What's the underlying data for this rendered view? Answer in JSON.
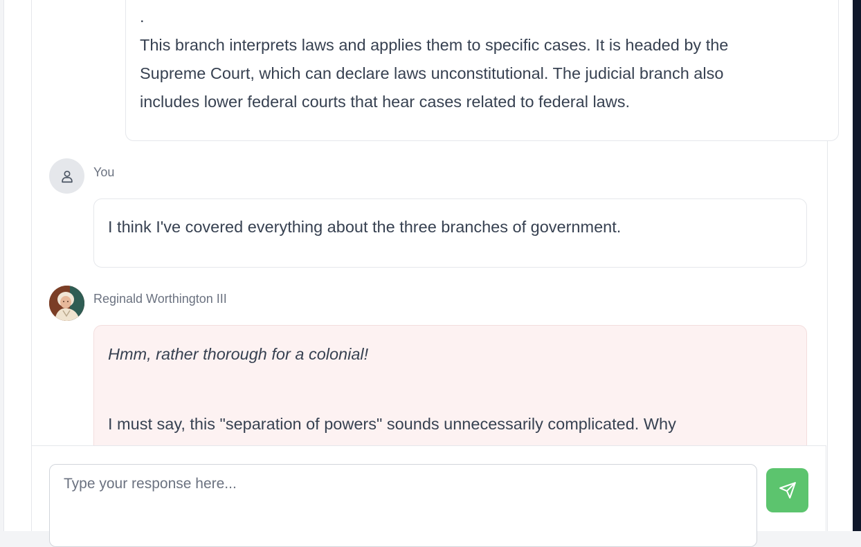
{
  "messages": [
    {
      "sender": "",
      "lines": [
        ".",
        "This branch interprets laws and applies them to specific cases. It is headed by the",
        "Supreme Court, which can declare laws unconstitutional. The judicial branch also",
        "includes lower federal courts that hear cases related to federal laws."
      ]
    },
    {
      "sender": "You",
      "avatar_icon": "user-icon",
      "text": "I think I've covered everything about the three branches of government."
    },
    {
      "sender": "Reginald Worthington III",
      "avatar_icon": "portrait-avatar",
      "italic_text": "Hmm, rather thorough for a colonial!",
      "text": "I must say, this \"separation of powers\" sounds unnecessarily complicated. Why"
    }
  ],
  "composer": {
    "placeholder": "Type your response here...",
    "value": "",
    "send_icon": "send-icon"
  },
  "colors": {
    "accent": "#5cc46e",
    "bot_bubble": "#fdf2f2",
    "sidebar_dark": "#0f172a"
  }
}
